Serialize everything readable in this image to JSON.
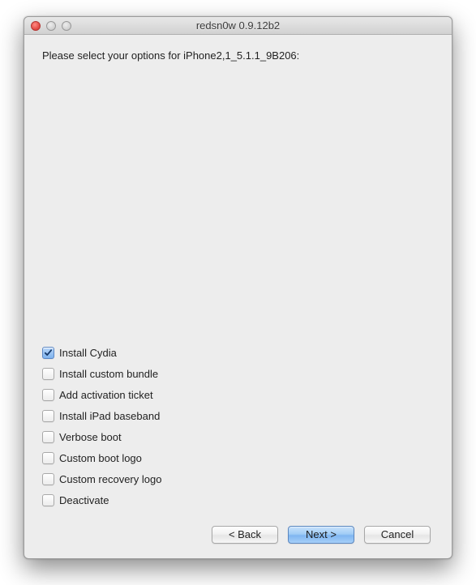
{
  "window": {
    "title": "redsn0w 0.9.12b2"
  },
  "content": {
    "instruction": "Please select your options for iPhone2,1_5.1.1_9B206:"
  },
  "options": [
    {
      "label": "Install Cydia",
      "checked": true
    },
    {
      "label": "Install custom bundle",
      "checked": false
    },
    {
      "label": "Add activation ticket",
      "checked": false
    },
    {
      "label": "Install iPad baseband",
      "checked": false
    },
    {
      "label": "Verbose boot",
      "checked": false
    },
    {
      "label": "Custom boot logo",
      "checked": false
    },
    {
      "label": "Custom recovery logo",
      "checked": false
    },
    {
      "label": "Deactivate",
      "checked": false
    }
  ],
  "buttons": {
    "back": "< Back",
    "next": "Next >",
    "cancel": "Cancel"
  }
}
